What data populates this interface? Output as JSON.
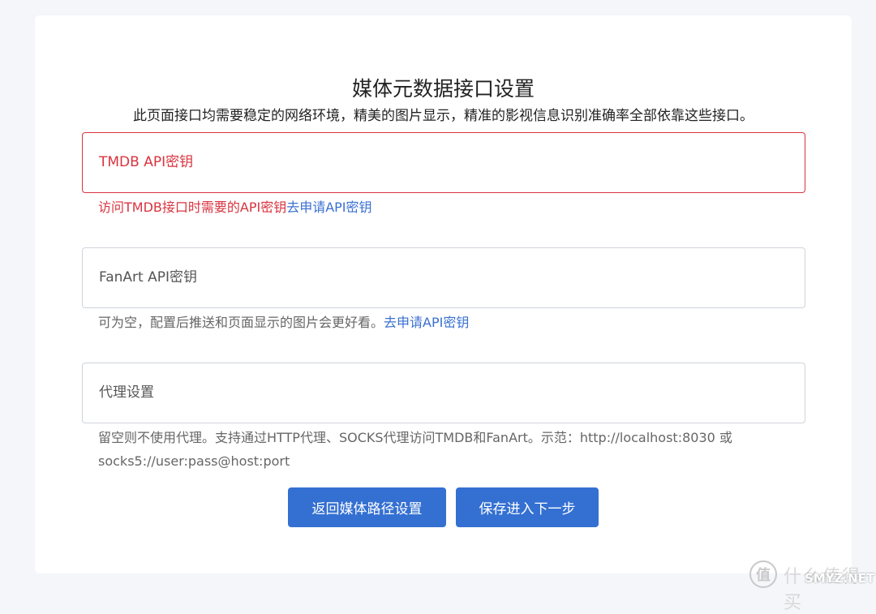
{
  "page": {
    "title": "媒体元数据接口设置",
    "subtitle": "此页面接口均需要稳定的网络环境，精美的图片显示，精准的影视信息识别准确率全部依靠这些接口。"
  },
  "fields": {
    "tmdb": {
      "label": "TMDB API密钥",
      "value": "",
      "help_text": "访问TMDB接口时需要的API密钥",
      "help_link": "去申请API密钥",
      "state_color": "#d9343f"
    },
    "fanart": {
      "label": "FanArt API密钥",
      "value": "",
      "help_text": "可为空，配置后推送和页面显示的图片会更好看。",
      "help_link": "去申请API密钥"
    },
    "proxy": {
      "label": "代理设置",
      "value": "",
      "help_line1": "留空则不使用代理。支持通过HTTP代理、SOCKS代理访问TMDB和FanArt。示范：http://localhost:8030 或",
      "help_line2": "socks5://user:pass@host:port"
    }
  },
  "actions": {
    "back_label": "返回媒体路径设置",
    "next_label": "保存进入下一步",
    "accent_color": "#3470d2"
  },
  "watermark": {
    "logo_icon": "zhi-icon",
    "logo_glyph": "值",
    "text_cn": "什么值得买",
    "text_en": "SMYZ.NET"
  }
}
